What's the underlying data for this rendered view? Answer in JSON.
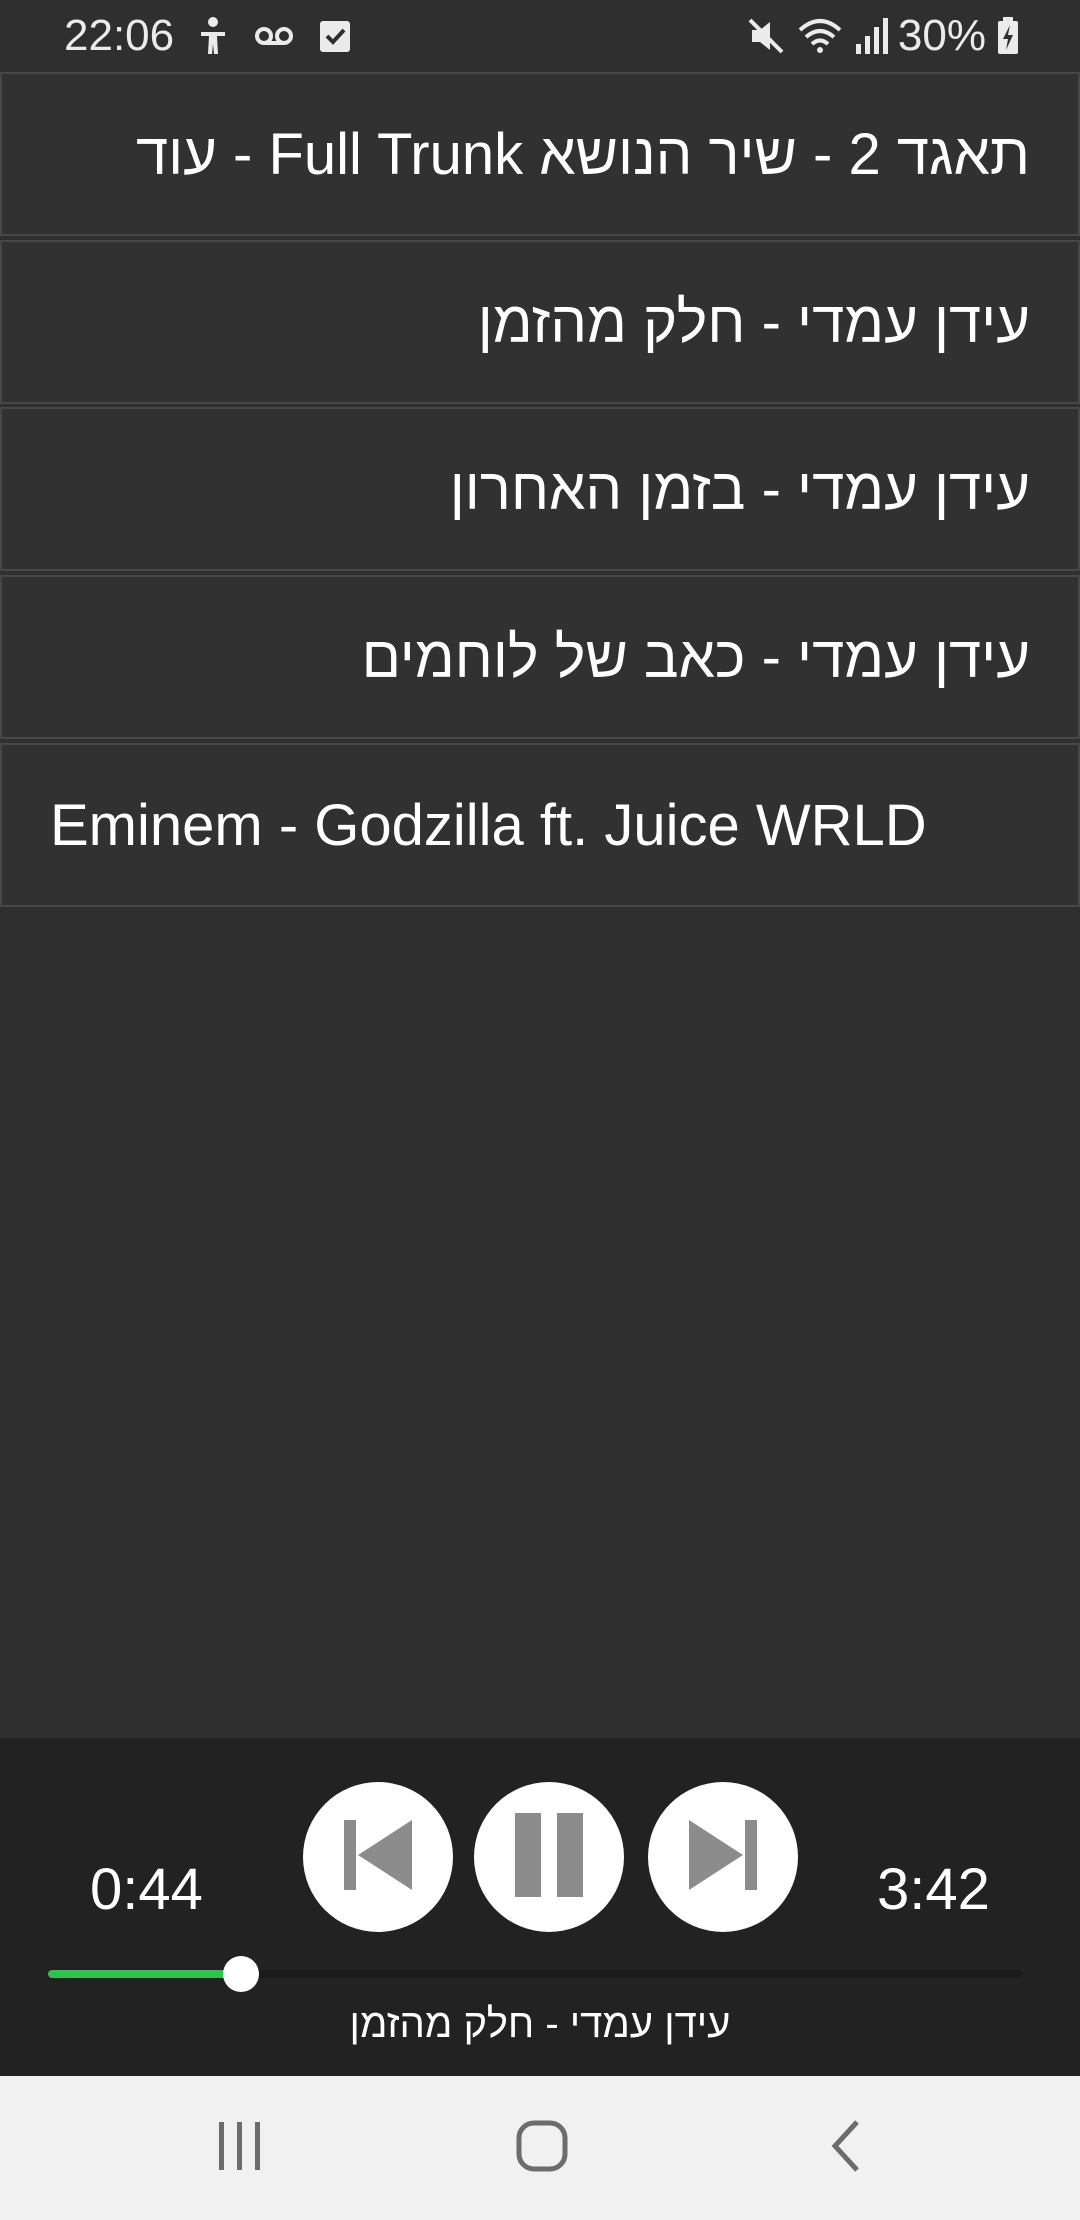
{
  "status_bar": {
    "time": "22:06",
    "battery_percent": "30%",
    "icons_left": [
      "accessibility-icon",
      "voicemail-icon",
      "task-check-icon"
    ],
    "icons_right": [
      "mute-icon",
      "wifi-icon",
      "signal-icon",
      "battery-charging-icon"
    ]
  },
  "playlist": [
    {
      "title": "תאגד 2 - שיר הנושא Full Trunk - עוד",
      "direction": "rtl"
    },
    {
      "title": "עידן עמדי - חלק מהזמן",
      "direction": "rtl"
    },
    {
      "title": "עידן עמדי - בזמן האחרון",
      "direction": "rtl"
    },
    {
      "title": "עידן עמדי - כאב של לוחמים",
      "direction": "rtl"
    },
    {
      "title": "Eminem - Godzilla ft. Juice WRLD",
      "direction": "ltr"
    }
  ],
  "player": {
    "elapsed": "0:44",
    "duration": "3:42",
    "progress_fraction": 0.198,
    "now_playing": "עידן עמדי - חלק מהזמן",
    "controls": [
      "previous-icon",
      "pause-icon",
      "next-icon"
    ],
    "colors": {
      "progress": "#2ec34a",
      "track": "#1b1b1b",
      "button_bg": "#ffffff",
      "button_icon": "#8c8c8c"
    }
  },
  "nav_bar": {
    "buttons": [
      "recent-apps-icon",
      "home-icon",
      "back-icon"
    ]
  }
}
